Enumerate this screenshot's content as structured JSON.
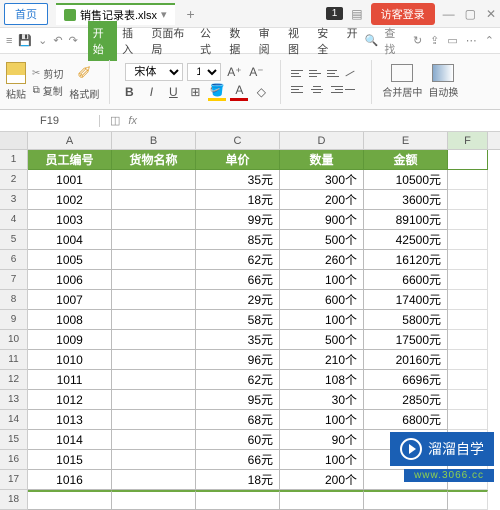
{
  "titlebar": {
    "home": "首页",
    "doc_name": "销售记录表.xlsx",
    "page_indicator": "1",
    "login": "访客登录"
  },
  "menu": {
    "items": [
      "开始",
      "插入",
      "页面布局",
      "公式",
      "数据",
      "审阅",
      "视图",
      "安全",
      "开"
    ],
    "search": "查找",
    "active_index": 0
  },
  "toolbar": {
    "paste": "粘贴",
    "cut": "剪切",
    "copy": "复制",
    "format_painter": "格式刷",
    "font_name": "宋体",
    "font_size": "11",
    "merge": "合并居中",
    "auto_wrap": "自动换"
  },
  "namebar": {
    "cell_ref": "F19",
    "fx": "fx"
  },
  "columns": [
    "A",
    "B",
    "C",
    "D",
    "E",
    "F"
  ],
  "header_row": [
    "员工编号",
    "货物名称",
    "单价",
    "数量",
    "金额"
  ],
  "data_rows": [
    {
      "n": "2",
      "a": "1001",
      "b": "",
      "c": "35元",
      "d": "300个",
      "e": "10500元"
    },
    {
      "n": "3",
      "a": "1002",
      "b": "",
      "c": "18元",
      "d": "200个",
      "e": "3600元"
    },
    {
      "n": "4",
      "a": "1003",
      "b": "",
      "c": "99元",
      "d": "900个",
      "e": "89100元"
    },
    {
      "n": "5",
      "a": "1004",
      "b": "",
      "c": "85元",
      "d": "500个",
      "e": "42500元"
    },
    {
      "n": "6",
      "a": "1005",
      "b": "",
      "c": "62元",
      "d": "260个",
      "e": "16120元"
    },
    {
      "n": "7",
      "a": "1006",
      "b": "",
      "c": "66元",
      "d": "100个",
      "e": "6600元"
    },
    {
      "n": "8",
      "a": "1007",
      "b": "",
      "c": "29元",
      "d": "600个",
      "e": "17400元"
    },
    {
      "n": "9",
      "a": "1008",
      "b": "",
      "c": "58元",
      "d": "100个",
      "e": "5800元"
    },
    {
      "n": "10",
      "a": "1009",
      "b": "",
      "c": "35元",
      "d": "500个",
      "e": "17500元"
    },
    {
      "n": "11",
      "a": "1010",
      "b": "",
      "c": "96元",
      "d": "210个",
      "e": "20160元"
    },
    {
      "n": "12",
      "a": "1011",
      "b": "",
      "c": "62元",
      "d": "108个",
      "e": "6696元"
    },
    {
      "n": "13",
      "a": "1012",
      "b": "",
      "c": "95元",
      "d": "30个",
      "e": "2850元"
    },
    {
      "n": "14",
      "a": "1013",
      "b": "",
      "c": "68元",
      "d": "100个",
      "e": "6800元"
    },
    {
      "n": "15",
      "a": "1014",
      "b": "",
      "c": "60元",
      "d": "90个",
      "e": ""
    },
    {
      "n": "16",
      "a": "1015",
      "b": "",
      "c": "66元",
      "d": "100个",
      "e": ""
    },
    {
      "n": "17",
      "a": "1016",
      "b": "",
      "c": "18元",
      "d": "200个",
      "e": ""
    }
  ],
  "watermark": {
    "title": "溜溜自学",
    "url": "www.3066.cc"
  }
}
